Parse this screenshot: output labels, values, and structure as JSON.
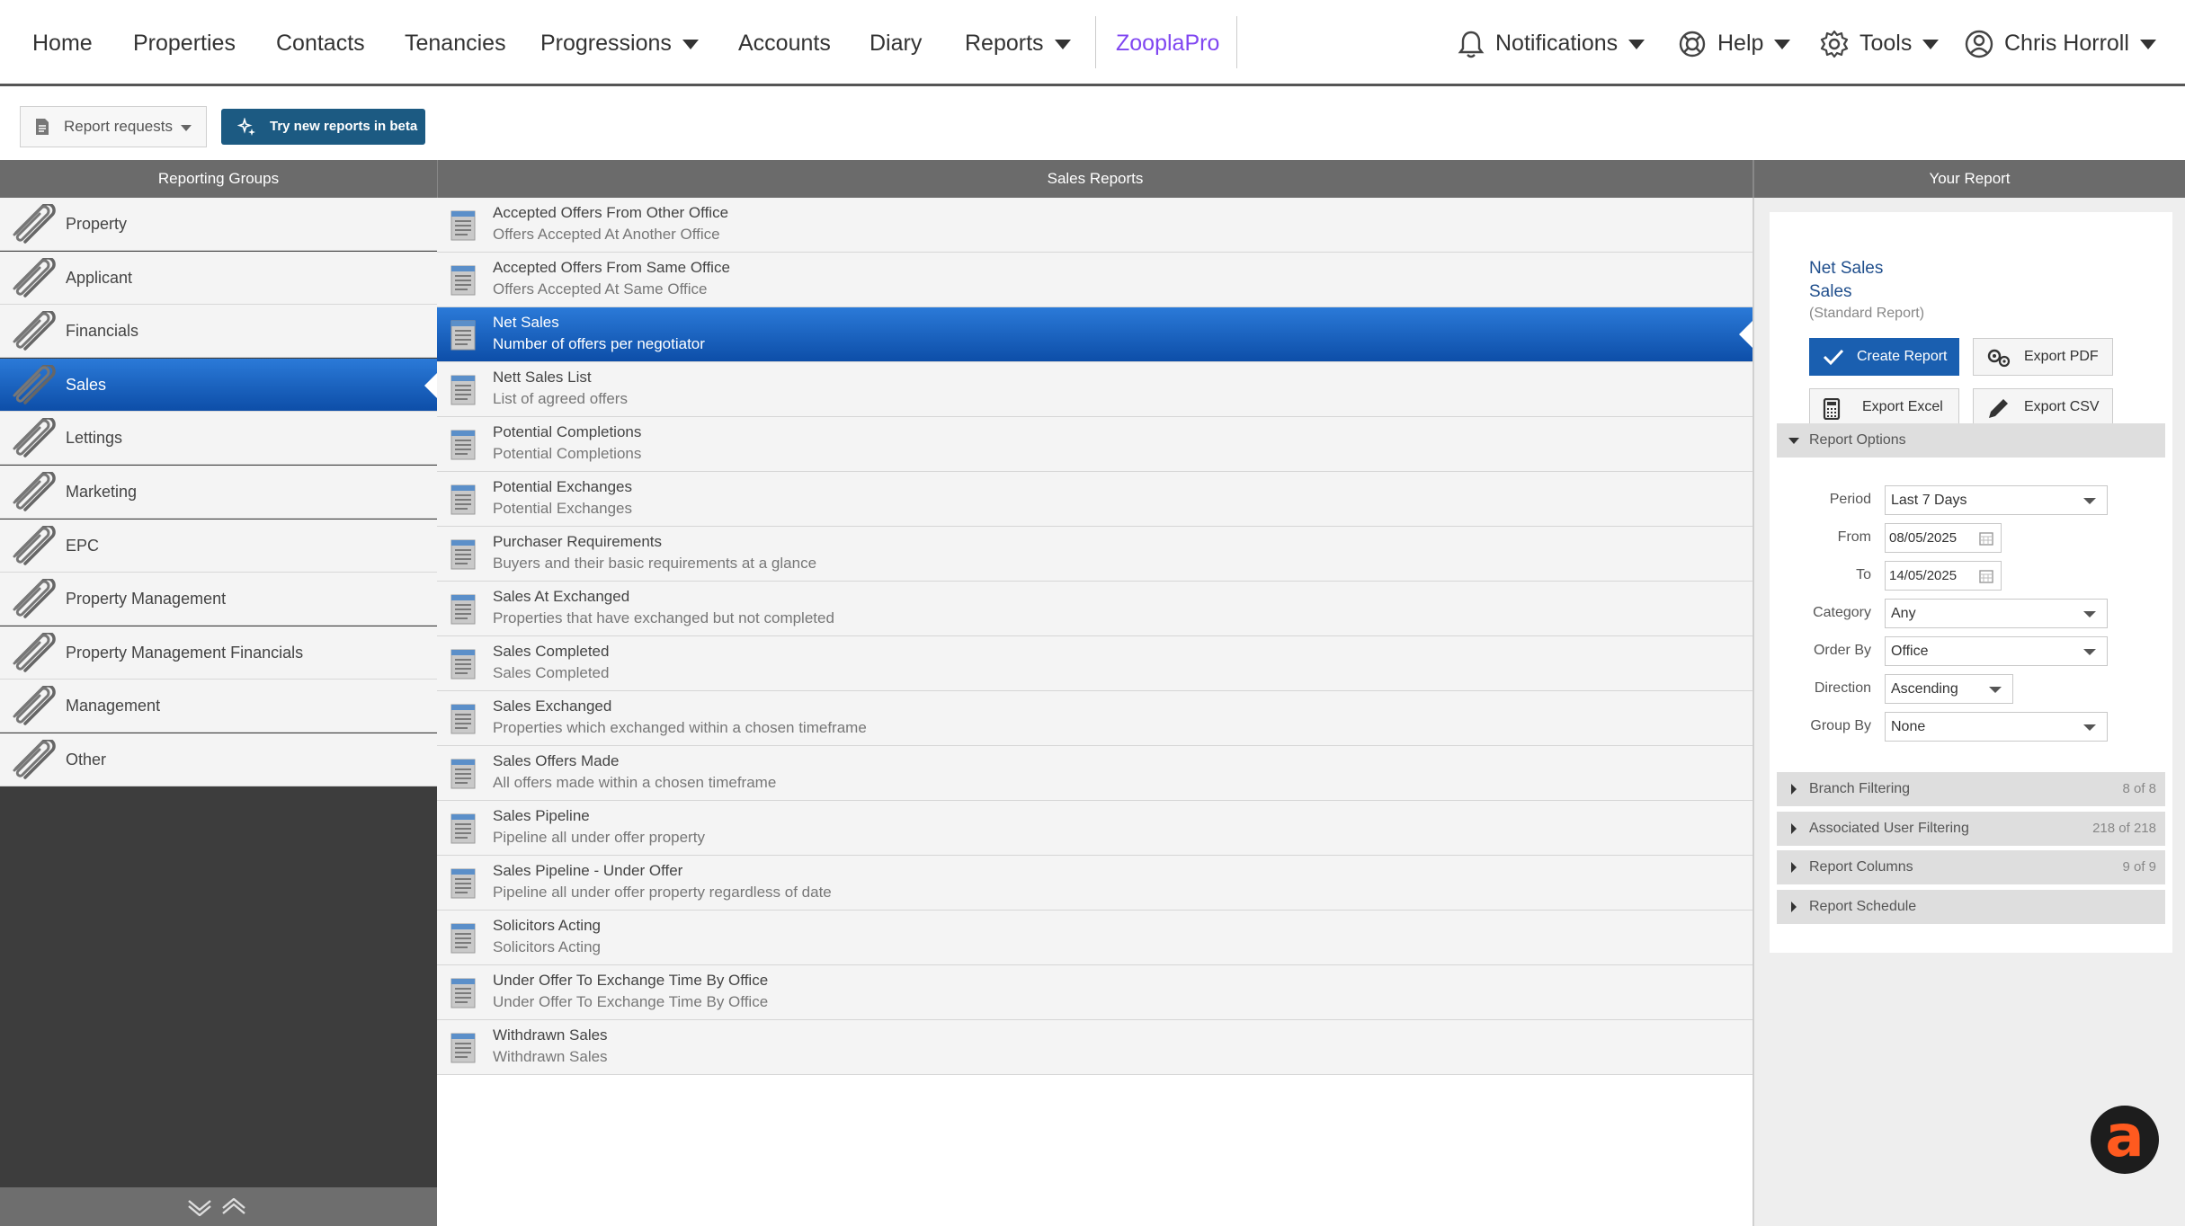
{
  "nav": {
    "home": "Home",
    "properties": "Properties",
    "contacts": "Contacts",
    "tenancies": "Tenancies",
    "progressions": "Progressions",
    "accounts": "Accounts",
    "diary": "Diary",
    "reports": "Reports",
    "zoopla": "ZooplaPro",
    "notifications": "Notifications",
    "help": "Help",
    "tools": "Tools",
    "user": "Chris Horroll"
  },
  "toolbar": {
    "report_requests": "Report requests",
    "beta_button": "Try new reports in beta"
  },
  "columns": {
    "groups": "Reporting Groups",
    "reports": "Sales Reports",
    "your_report": "Your Report"
  },
  "groups": [
    {
      "label": "Property"
    },
    {
      "label": "Applicant"
    },
    {
      "label": "Financials"
    },
    {
      "label": "Sales"
    },
    {
      "label": "Lettings"
    },
    {
      "label": "Marketing"
    },
    {
      "label": "EPC"
    },
    {
      "label": "Property Management"
    },
    {
      "label": "Property Management Financials"
    },
    {
      "label": "Management"
    },
    {
      "label": "Other"
    }
  ],
  "active_group": 3,
  "reports": [
    {
      "title": "Accepted Offers From Other Office",
      "desc": "Offers Accepted At Another Office"
    },
    {
      "title": "Accepted Offers From Same Office",
      "desc": "Offers Accepted At Same Office"
    },
    {
      "title": "Net Sales",
      "desc": "Number of offers per negotiator"
    },
    {
      "title": "Nett Sales List",
      "desc": "List of agreed offers"
    },
    {
      "title": "Potential Completions",
      "desc": "Potential Completions"
    },
    {
      "title": "Potential Exchanges",
      "desc": "Potential Exchanges"
    },
    {
      "title": "Purchaser Requirements",
      "desc": "Buyers and their basic requirements at a glance"
    },
    {
      "title": "Sales At Exchanged",
      "desc": "Properties that have exchanged but not completed"
    },
    {
      "title": "Sales Completed",
      "desc": "Sales Completed"
    },
    {
      "title": "Sales Exchanged",
      "desc": "Properties which exchanged within a chosen timeframe"
    },
    {
      "title": "Sales Offers Made",
      "desc": "All offers made within a chosen timeframe"
    },
    {
      "title": "Sales Pipeline",
      "desc": "Pipeline all under offer property"
    },
    {
      "title": "Sales Pipeline - Under Offer",
      "desc": "Pipeline all under offer property regardless of date"
    },
    {
      "title": "Solicitors Acting",
      "desc": "Solicitors Acting"
    },
    {
      "title": "Under Offer To Exchange Time By Office",
      "desc": "Under Offer To Exchange Time By Office"
    },
    {
      "title": "Withdrawn Sales",
      "desc": "Withdrawn Sales"
    }
  ],
  "active_report": 2,
  "your_report": {
    "name": "Net Sales",
    "group": "Sales",
    "kind": "(Standard Report)",
    "create": "Create Report",
    "export_pdf": "Export PDF",
    "export_excel": "Export Excel",
    "export_csv": "Export CSV",
    "options_title": "Report Options",
    "options": {
      "period_label": "Period",
      "period": "Last 7 Days",
      "from_label": "From",
      "from": "08/05/2025",
      "to_label": "To",
      "to": "14/05/2025",
      "category_label": "Category",
      "category": "Any",
      "order_label": "Order By",
      "order": "Office",
      "direction_label": "Direction",
      "direction": "Ascending",
      "group_label": "Group By",
      "group": "None"
    },
    "sections": [
      {
        "label": "Branch Filtering",
        "count": "8 of 8"
      },
      {
        "label": "Associated User Filtering",
        "count": "218 of 218"
      },
      {
        "label": "Report Columns",
        "count": "9 of 9"
      },
      {
        "label": "Report Schedule",
        "count": ""
      }
    ]
  },
  "assist_logo": "a",
  "colors": {
    "active_gradient_top": "#2b7ad8",
    "active_gradient_bottom": "#0d4ea8",
    "zoopla": "#8046f1",
    "beta_button": "#1c5a82",
    "assist_logo": "#ff5a1f"
  }
}
